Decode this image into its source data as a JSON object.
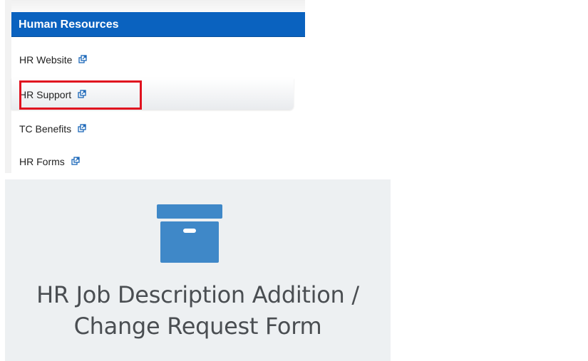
{
  "hr_menu": {
    "header": "Human Resources",
    "items": [
      {
        "label": "HR Website"
      },
      {
        "label": "HR Support"
      },
      {
        "label": "TC Benefits"
      },
      {
        "label": "HR Forms"
      }
    ],
    "highlighted_item": "HR Support",
    "icon": "external-link-icon",
    "colors": {
      "header_bg": "#0a62bf",
      "highlight_border": "#e0121f"
    }
  },
  "form_tile": {
    "icon": "archive-box-icon",
    "title_line1": "HR Job Description Addition /",
    "title_line2": "Change Request Form",
    "colors": {
      "background": "#edf0f2",
      "icon": "#3f88c8"
    }
  }
}
